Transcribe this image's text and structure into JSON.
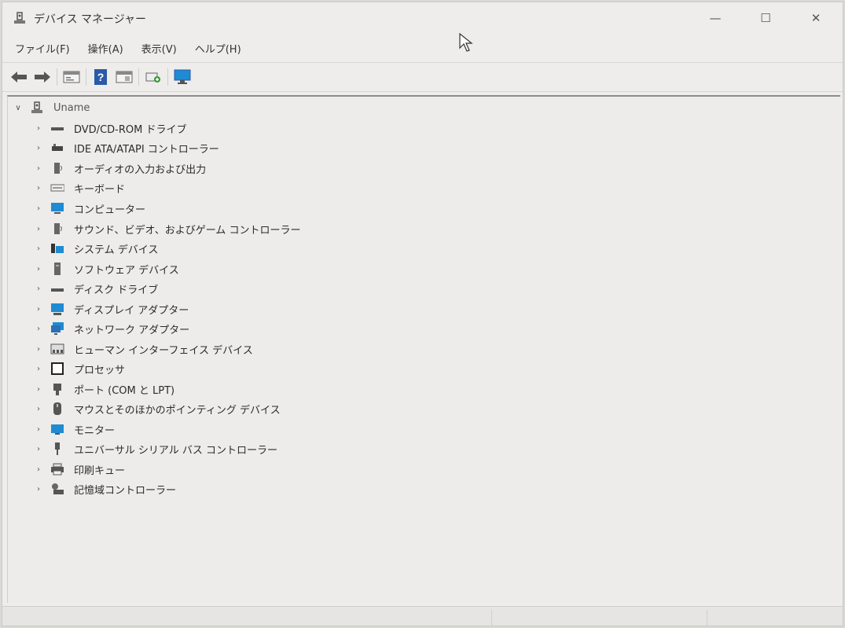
{
  "window": {
    "title": "デバイス マネージャー",
    "min_glyph": "—",
    "max_glyph": "☐",
    "close_glyph": "✕"
  },
  "menu": [
    {
      "label": "ファイル(F)"
    },
    {
      "label": "操作(A)"
    },
    {
      "label": "表示(V)"
    },
    {
      "label": "ヘルプ(H)"
    }
  ],
  "toolbar": {
    "buttons": [
      "back-arrow-icon",
      "forward-arrow-icon",
      "properties-icon",
      "help-icon",
      "view-icon",
      "scan-hardware-icon",
      "monitor-icon"
    ]
  },
  "tree": {
    "root": {
      "label": "Uname",
      "expanded": true,
      "icon": "computer-user-icon"
    },
    "children": [
      {
        "label": "DVD/CD-ROM ドライブ",
        "icon": "dvd-drive-icon"
      },
      {
        "label": "IDE ATA/ATAPI コントローラー",
        "icon": "ide-controller-icon"
      },
      {
        "label": "オーディオの入力および出力",
        "icon": "speaker-icon"
      },
      {
        "label": "キーボード",
        "icon": "keyboard-icon"
      },
      {
        "label": "コンピューター",
        "icon": "computer-icon"
      },
      {
        "label": "サウンド、ビデオ、およびゲーム コントローラー",
        "icon": "sound-icon"
      },
      {
        "label": "システム デバイス",
        "icon": "system-device-icon"
      },
      {
        "label": "ソフトウェア デバイス",
        "icon": "software-device-icon"
      },
      {
        "label": "ディスク ドライブ",
        "icon": "disk-drive-icon"
      },
      {
        "label": "ディスプレイ アダプター",
        "icon": "display-adapter-icon"
      },
      {
        "label": "ネットワーク アダプター",
        "icon": "network-adapter-icon"
      },
      {
        "label": "ヒューマン インターフェイス デバイス",
        "icon": "hid-icon"
      },
      {
        "label": "プロセッサ",
        "icon": "processor-icon"
      },
      {
        "label": "ポート (COM と LPT)",
        "icon": "port-icon"
      },
      {
        "label": "マウスとそのほかのポインティング デバイス",
        "icon": "mouse-icon"
      },
      {
        "label": "モニター",
        "icon": "monitor-icon"
      },
      {
        "label": "ユニバーサル シリアル バス コントローラー",
        "icon": "usb-icon"
      },
      {
        "label": "印刷キュー",
        "icon": "printer-icon"
      },
      {
        "label": "記憶域コントローラー",
        "icon": "storage-controller-icon"
      }
    ]
  },
  "colors": {
    "accent": "#1e8bd3",
    "background": "#eeedeb",
    "text": "#2b2b2b"
  }
}
